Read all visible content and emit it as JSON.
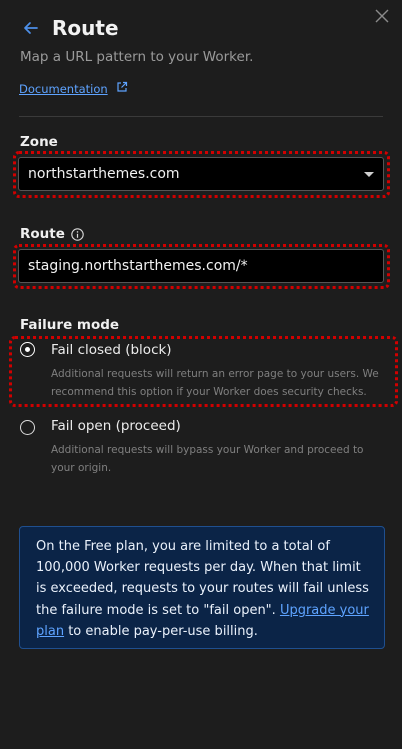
{
  "header": {
    "title": "Route",
    "subtitle": "Map a URL pattern to your Worker."
  },
  "links": {
    "documentation": "Documentation"
  },
  "zone": {
    "label": "Zone",
    "value": "northstarthemes.com"
  },
  "route": {
    "label": "Route",
    "value": "staging.northstarthemes.com/*"
  },
  "failure_mode": {
    "label": "Failure mode",
    "options": [
      {
        "label": "Fail closed (block)",
        "description": "Additional requests will return an error page to your users. We recommend this option if your Worker does security checks.",
        "selected": true
      },
      {
        "label": "Fail open (proceed)",
        "description": "Additional requests will bypass your Worker and proceed to your origin.",
        "selected": false
      }
    ]
  },
  "notice": {
    "text_before": "On the Free plan, you are limited to a total of 100,000 Worker requests per day. When that limit is exceeded, requests to your routes will fail unless the failure mode is set to \"fail open\". ",
    "link": "Upgrade your plan",
    "text_after": " to enable pay-per-use billing."
  },
  "colors": {
    "accent": "#5ea3ff",
    "highlight": "#d10000",
    "notice_bg": "#0b2447"
  },
  "icons": {
    "back": "arrow-left-icon",
    "close": "close-icon",
    "external": "external-link-icon",
    "info": "info-icon",
    "dropdown": "chevron-down-icon"
  }
}
